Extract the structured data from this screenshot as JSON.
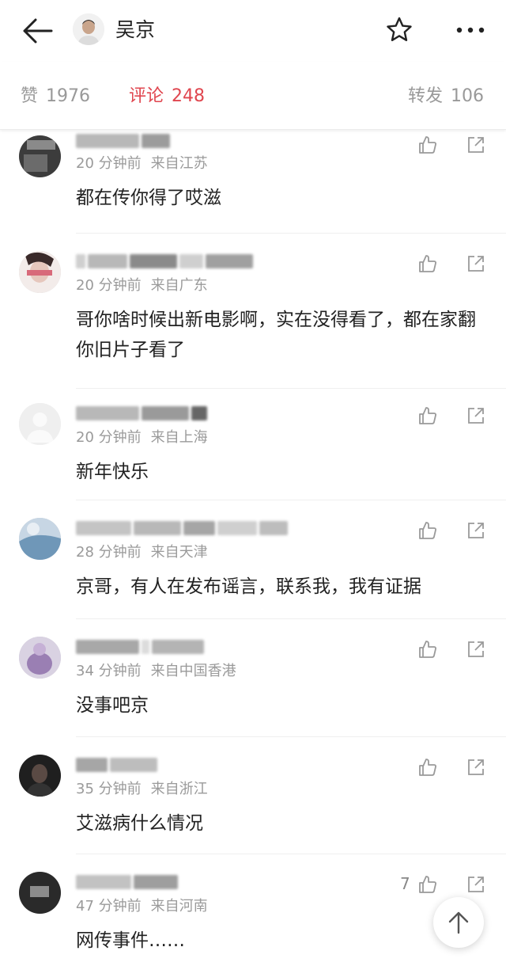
{
  "header": {
    "name": "吴京",
    "back_icon": "arrow-left-icon",
    "star_icon": "star-icon",
    "more_icon": "more-horizontal-icon"
  },
  "tabs": [
    {
      "label": "赞",
      "count": "1976",
      "active": false
    },
    {
      "label": "评论",
      "count": "248",
      "active": true
    },
    {
      "label": "转发",
      "count": "106",
      "active": false
    }
  ],
  "colors": {
    "accent": "#e0464f",
    "muted": "#999999",
    "divider": "#efefef"
  },
  "comments": [
    {
      "time": "20 分钟前",
      "location": "来自江苏",
      "text": "都在传你得了哎滋",
      "likes": ""
    },
    {
      "time": "20 分钟前",
      "location": "来自广东",
      "text": "哥你啥时候出新电影啊，实在没得看了，都在家翻你旧片子看了",
      "likes": ""
    },
    {
      "time": "20 分钟前",
      "location": "来自上海",
      "text": "新年快乐",
      "likes": ""
    },
    {
      "time": "28 分钟前",
      "location": "来自天津",
      "text": "京哥，有人在发布谣言，联系我，我有证据",
      "likes": ""
    },
    {
      "time": "34 分钟前",
      "location": "来自中国香港",
      "text": "没事吧京",
      "likes": ""
    },
    {
      "time": "35 分钟前",
      "location": "来自浙江",
      "text": "艾滋病什么情况",
      "likes": ""
    },
    {
      "time": "47 分钟前",
      "location": "来自河南",
      "text": "网传事件……",
      "likes": "7"
    }
  ],
  "icons": {
    "like": "thumbs-up-icon",
    "share": "share-icon",
    "scroll_top": "arrow-up-icon"
  }
}
